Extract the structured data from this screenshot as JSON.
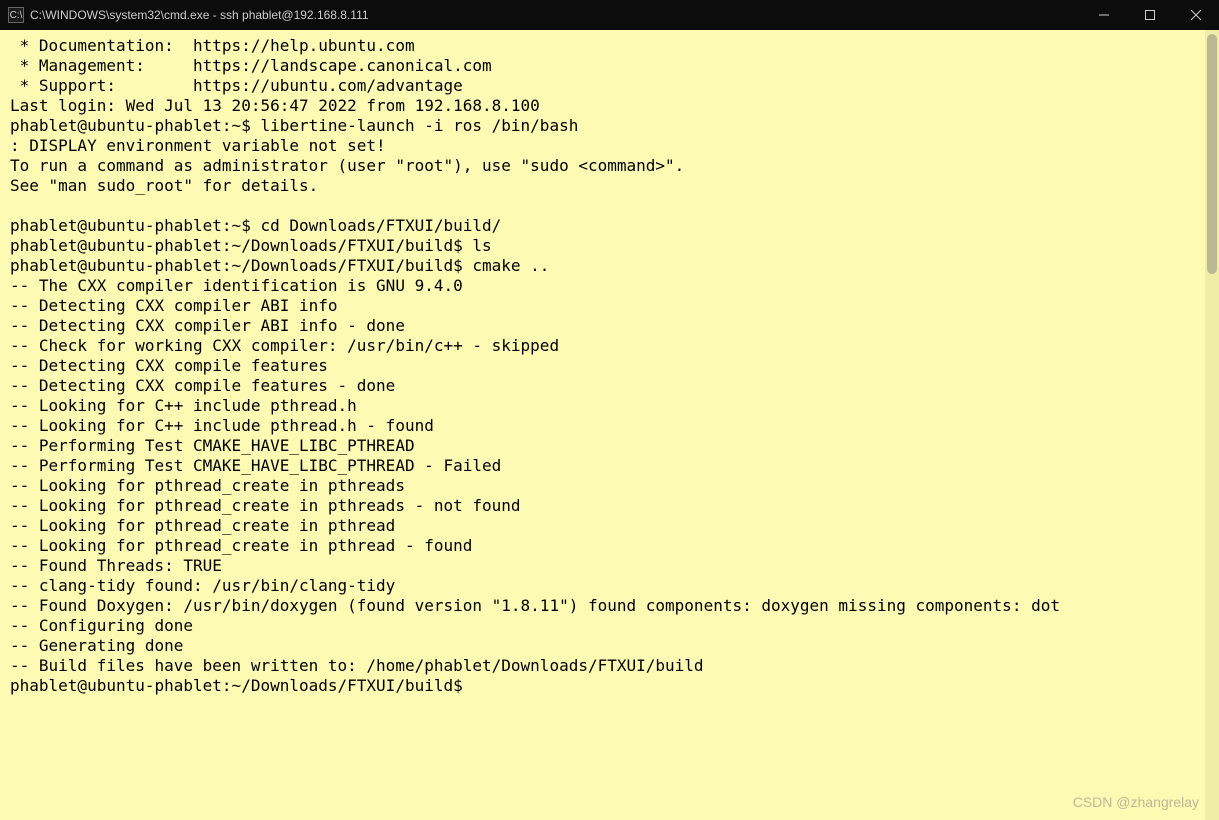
{
  "window": {
    "title": "C:\\WINDOWS\\system32\\cmd.exe - ssh  phablet@192.168.8.111",
    "icon_label": "C:\\"
  },
  "terminal": {
    "lines": [
      " * Documentation:  https://help.ubuntu.com",
      " * Management:     https://landscape.canonical.com",
      " * Support:        https://ubuntu.com/advantage",
      "Last login: Wed Jul 13 20:56:47 2022 from 192.168.8.100",
      "phablet@ubuntu-phablet:~$ libertine-launch -i ros /bin/bash",
      ": DISPLAY environment variable not set!",
      "To run a command as administrator (user \"root\"), use \"sudo <command>\".",
      "See \"man sudo_root\" for details.",
      "",
      "phablet@ubuntu-phablet:~$ cd Downloads/FTXUI/build/",
      "phablet@ubuntu-phablet:~/Downloads/FTXUI/build$ ls",
      "phablet@ubuntu-phablet:~/Downloads/FTXUI/build$ cmake ..",
      "-- The CXX compiler identification is GNU 9.4.0",
      "-- Detecting CXX compiler ABI info",
      "-- Detecting CXX compiler ABI info - done",
      "-- Check for working CXX compiler: /usr/bin/c++ - skipped",
      "-- Detecting CXX compile features",
      "-- Detecting CXX compile features - done",
      "-- Looking for C++ include pthread.h",
      "-- Looking for C++ include pthread.h - found",
      "-- Performing Test CMAKE_HAVE_LIBC_PTHREAD",
      "-- Performing Test CMAKE_HAVE_LIBC_PTHREAD - Failed",
      "-- Looking for pthread_create in pthreads",
      "-- Looking for pthread_create in pthreads - not found",
      "-- Looking for pthread_create in pthread",
      "-- Looking for pthread_create in pthread - found",
      "-- Found Threads: TRUE",
      "-- clang-tidy found: /usr/bin/clang-tidy",
      "-- Found Doxygen: /usr/bin/doxygen (found version \"1.8.11\") found components: doxygen missing components: dot",
      "-- Configuring done",
      "-- Generating done",
      "-- Build files have been written to: /home/phablet/Downloads/FTXUI/build",
      "phablet@ubuntu-phablet:~/Downloads/FTXUI/build$"
    ]
  },
  "watermark": "CSDN @zhangrelay"
}
